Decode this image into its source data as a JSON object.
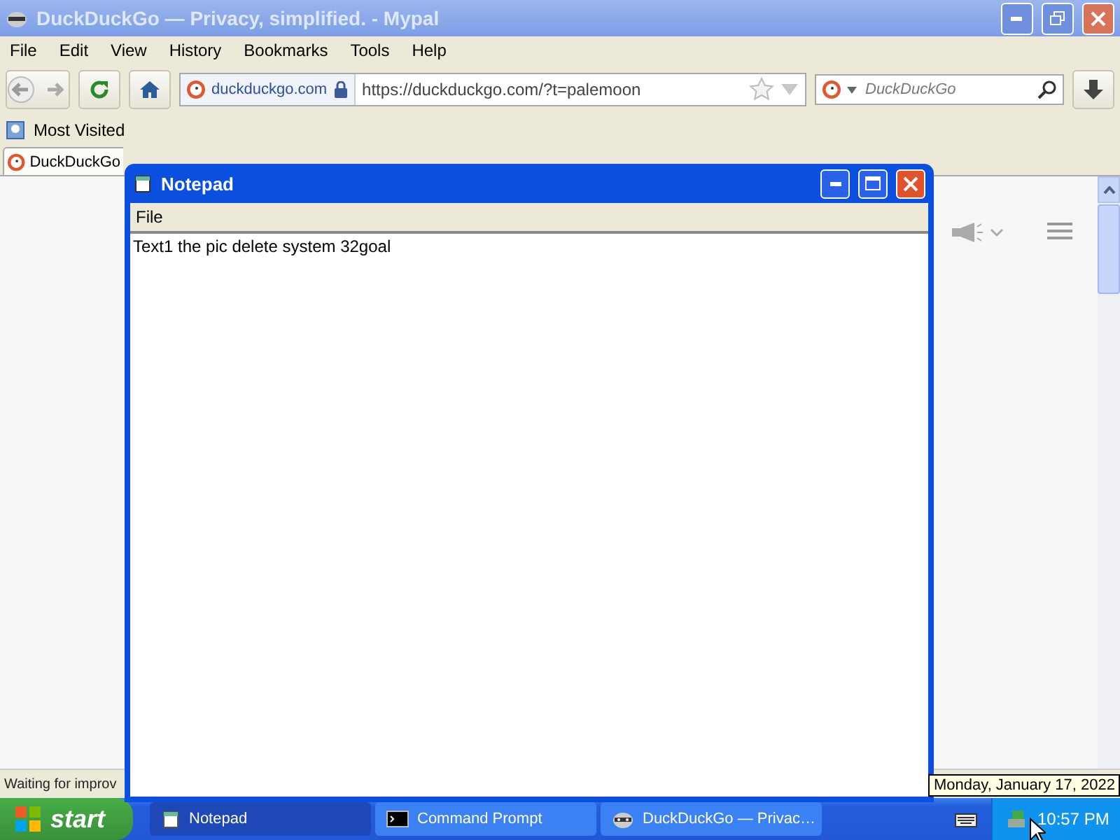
{
  "browser": {
    "title": "DuckDuckGo — Privacy, simplified. - Mypal",
    "menu": [
      {
        "label": "File"
      },
      {
        "label": "Edit"
      },
      {
        "label": "View"
      },
      {
        "label": "History"
      },
      {
        "label": "Bookmarks"
      },
      {
        "label": "Tools"
      },
      {
        "label": "Help"
      }
    ],
    "url_domain": "duckduckgo.com",
    "url": "https://duckduckgo.com/?t=palemoon",
    "search_placeholder": "DuckDuckGo",
    "bookmarks": [
      {
        "label": "Most Visited"
      }
    ],
    "tabs": [
      {
        "label": "DuckDuckGo",
        "selected": true
      }
    ],
    "status": "Waiting for improv"
  },
  "notepad": {
    "title": "Notepad",
    "menu": [
      {
        "label": "File"
      }
    ],
    "text": "Text1 the pic delete system 32goal"
  },
  "taskbar": {
    "start": "start",
    "tasks": [
      {
        "label": "Notepad",
        "kind": "notepad",
        "selected": true
      },
      {
        "label": "Command Prompt",
        "kind": "console",
        "selected": false
      },
      {
        "label": "DuckDuckGo — Privac…",
        "kind": "browser",
        "selected": false
      }
    ],
    "clock": "10:57 PM",
    "tooltip": "Monday, January 17, 2022"
  }
}
